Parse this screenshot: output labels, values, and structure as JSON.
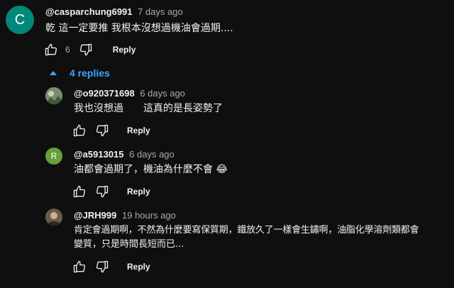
{
  "comments": [
    {
      "author": "@casparchung6991",
      "time": "7 days ago",
      "text": "乾 這一定要推 我根本沒想過機油會過期....",
      "likes": "6",
      "reply_label": "Reply",
      "avatar_letter": "C",
      "avatar_color": "#00897b"
    }
  ],
  "replies_toggle": {
    "label": "4 replies"
  },
  "replies": [
    {
      "author": "@o920371698",
      "time": "6 days ago",
      "text": "我也沒想過　　這真的是長姿勢了",
      "reply_label": "Reply"
    },
    {
      "author": "@a5913015",
      "time": "6 days ago",
      "text": "油都會過期了，機油為什麼不會 😂",
      "reply_label": "Reply",
      "avatar_letter": "R",
      "avatar_color": "#689f38"
    },
    {
      "author": "@JRH999",
      "time": "19 hours ago",
      "text_line1": "肯定會過期啊，不然為什麼要寫保質期，鐵放久了一樣會生鏽啊，油脂化學溶劑類都會",
      "text_line2": "變質，只是時間長短而已...",
      "reply_label": "Reply"
    }
  ],
  "icons": {
    "like": "thumbs-up-icon",
    "dislike": "thumbs-down-icon",
    "toggle": "caret-up-icon"
  }
}
